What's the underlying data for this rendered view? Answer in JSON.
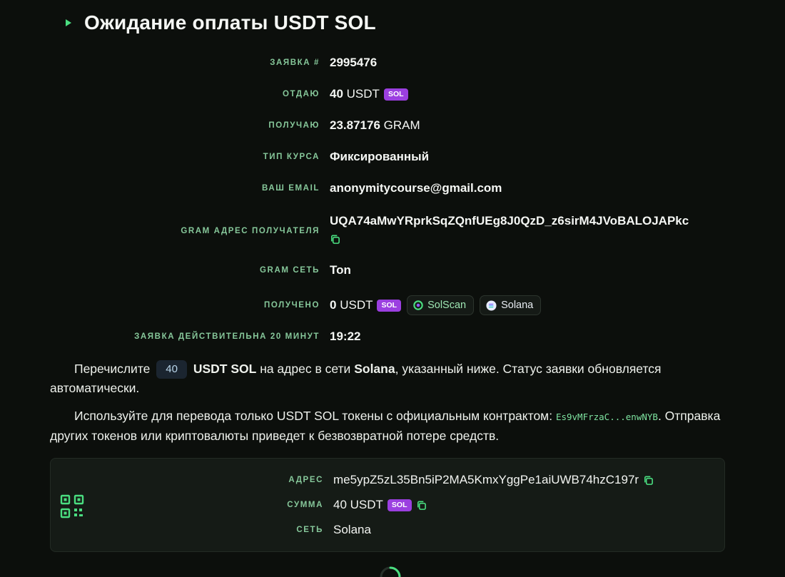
{
  "header": {
    "title": "Ожидание оплаты USDT SOL"
  },
  "order": {
    "id_label": "ЗАЯВКА #",
    "id_value": "2995476",
    "give_label": "ОТДАЮ",
    "give_amount": "40",
    "give_currency": "USDT",
    "give_network_badge": "SOL",
    "receive_label": "ПОЛУЧАЮ",
    "receive_amount": "23.87176",
    "receive_currency": "GRAM",
    "rate_label": "ТИП КУРСА",
    "rate_value": "Фиксированный",
    "email_label": "ВАШ EMAIL",
    "email_value": "anonymitycourse@gmail.com",
    "recipient_label": "GRAM АДРЕС ПОЛУЧАТЕЛЯ",
    "recipient_value": "UQA74aMwYRprkSqZQnfUEg8J0QzD_z6sirM4JVoBALOJAPkc",
    "network_label": "GRAM СЕТЬ",
    "network_value": "Ton",
    "received_label": "ПОЛУЧЕНО",
    "received_amount": "0",
    "received_currency": "USDT",
    "received_network_badge": "SOL",
    "solscan_label": "SolScan",
    "solana_label": "Solana",
    "timer_label": "ЗАЯВКА ДЕЙСТВИТЕЛЬНА 20 МИНУТ",
    "timer_value": "19:22"
  },
  "instructions": {
    "p1_prefix": "Перечислите",
    "p1_amount": "40",
    "p1_coin": "USDT SOL",
    "p1_middle": "на адрес в сети",
    "p1_network": "Solana",
    "p1_suffix": ", указанный ниже. Статус заявки обновляется автоматически.",
    "p2_prefix": "Используйте для перевода только USDT SOL токены с официальным контрактом:",
    "p2_contract": "Es9vMFrzaC...enwNYB",
    "p2_suffix": ". Отправка других токенов или криптовалюты приведет к безвозвратной потере средств."
  },
  "payment": {
    "address_label": "АДРЕС",
    "address_value": "me5ypZ5zL35Bn5iP2MA5KmxYggPe1aiUWB74hzC197r",
    "amount_label": "СУММА",
    "amount_value": "40 USDT",
    "amount_badge": "SOL",
    "network_label": "СЕТЬ",
    "network_value": "Solana"
  },
  "colors": {
    "background": "#0c0f0c",
    "accent_green": "#4ade80",
    "label_green": "#86c79a",
    "sol_badge": "#9b3fe0",
    "panel": "#151b16"
  },
  "icons": {
    "title_marker": "triangle-right-icon",
    "copy": "copy-icon",
    "qr": "qr-code-icon",
    "solscan": "solscan-logo-icon",
    "solana": "solana-logo-icon",
    "loading": "spinner-icon"
  }
}
